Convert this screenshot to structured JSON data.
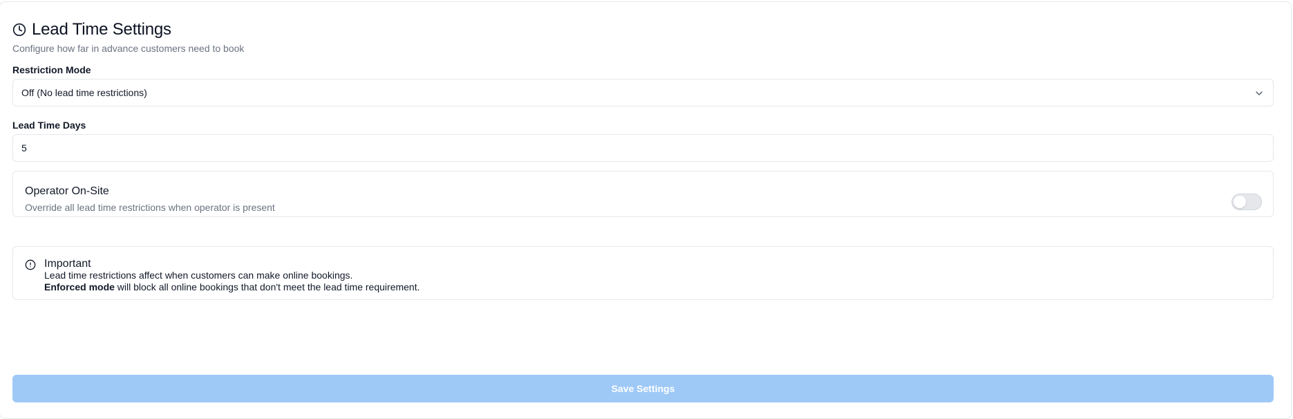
{
  "header": {
    "icon": "clock-icon",
    "title": "Lead Time Settings",
    "subtitle": "Configure how far in advance customers need to book"
  },
  "restriction_mode": {
    "label": "Restriction Mode",
    "selected": "Off (No lead time restrictions)",
    "icon": "chevron-down-icon"
  },
  "lead_time_days": {
    "label": "Lead Time Days",
    "value": "5"
  },
  "operator_onsite": {
    "title": "Operator On-Site",
    "description": "Override all lead time restrictions when operator is present",
    "toggle_on": false
  },
  "alert": {
    "icon": "alert-circle-icon",
    "title": "Important",
    "line1": "Lead time restrictions affect when customers can make online bookings.",
    "line2_bold": "Enforced mode",
    "line2_rest": " will block all online bookings that don't meet the lead time requirement."
  },
  "save_button": {
    "label": "Save Settings",
    "color": "#9ec9f7"
  }
}
